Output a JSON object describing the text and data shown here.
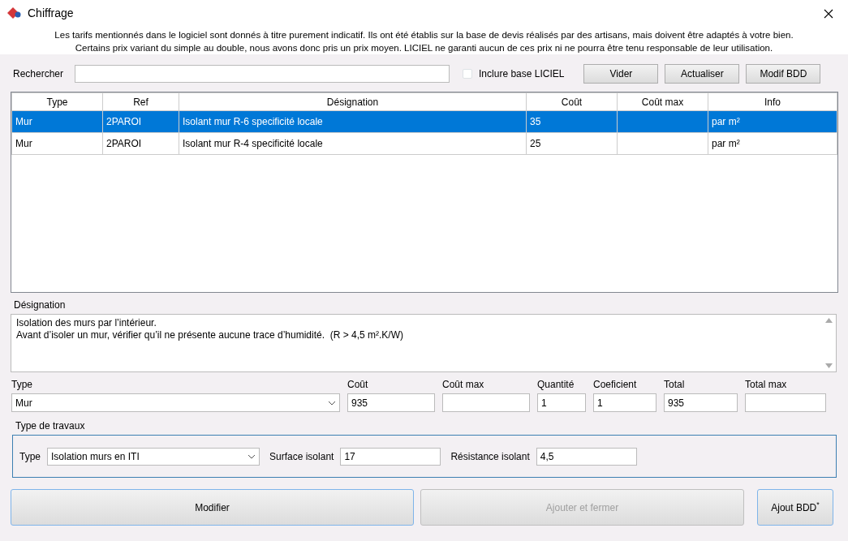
{
  "window": {
    "title": "Chiffrage"
  },
  "notice": [
    "Les tarifs mentionnés dans le logiciel sont donnés à titre purement indicatif. Ils ont été établis sur la base de devis réalisés par des artisans, mais doivent être adaptés à votre bien.",
    "Certains prix variant du simple au double, nous avons donc pris un prix moyen. LICIEL ne garanti aucun de ces prix ni ne pourra être tenu responsable de leur utilisation."
  ],
  "search": {
    "label": "Rechercher",
    "include": {
      "label": "Inclure base LICIEL",
      "checked": false
    },
    "buttons": [
      "Vider",
      "Actualiser",
      "Modif BDD"
    ]
  },
  "table": {
    "columns": [
      "Type",
      "Ref",
      "Désignation",
      "Coût",
      "Coût max",
      "Info"
    ],
    "rows": [
      {
        "cells": [
          "Mur",
          "2PAROI",
          "Isolant mur R-6 specificité locale",
          "35",
          "",
          "par m²"
        ],
        "selected": true
      },
      {
        "cells": [
          "Mur",
          "2PAROI",
          "Isolant mur R-4 specificité locale",
          "25",
          "",
          "par m²"
        ],
        "selected": false
      }
    ]
  },
  "designation": {
    "label": "Désignation",
    "text": "Isolation des murs par l’intérieur.\nAvant d’isoler un mur, vérifier qu’il ne présente aucune trace d’humidité.  (R > 4,5 m².K/W)"
  },
  "fields": [
    {
      "label": "Type",
      "value": "Mur",
      "kind": "select"
    },
    {
      "label": "Coût",
      "value": "935",
      "kind": "input"
    },
    {
      "label": "Coût max",
      "kind": "input"
    },
    {
      "label": "Quantité",
      "value": "1",
      "kind": "input"
    },
    {
      "label": "Coeficient",
      "value": "1",
      "kind": "input"
    },
    {
      "label": "Total",
      "value": "935",
      "kind": "input"
    },
    {
      "label": "Total max",
      "kind": "input"
    }
  ],
  "travaux": {
    "label": "Type de travaux",
    "fields": [
      {
        "label": "Type",
        "value": "Isolation murs en ITI",
        "kind": "select"
      },
      {
        "label": "Surface isolant",
        "value": "17",
        "kind": "input"
      },
      {
        "label": "Résistance isolant",
        "value": "4,5",
        "kind": "input"
      }
    ]
  },
  "actions": [
    {
      "label": "Modifier",
      "disabled": false
    },
    {
      "label": "Ajouter et fermer",
      "disabled": true
    },
    {
      "label": "Ajout BDD$^{*}$",
      "disabled": false
    }
  ]
}
